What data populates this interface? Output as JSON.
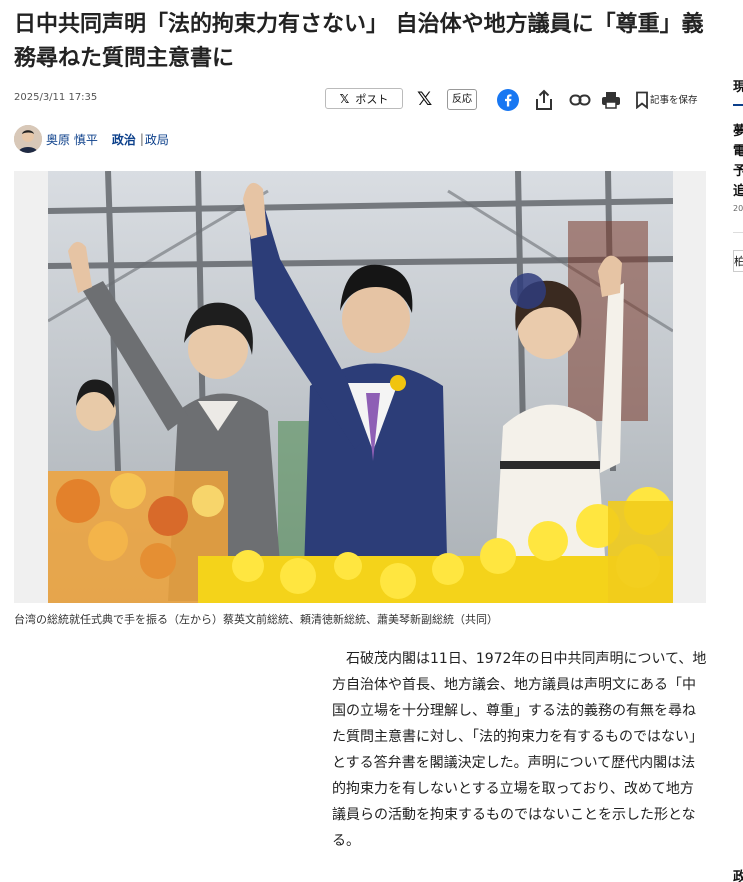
{
  "article": {
    "title": "日中共同声明「法的拘束力有さない」 自治体や地方議員に「尊重」義務尋ねた質問主意書に",
    "date": "2025/3/11 17:35",
    "author": "奥原 慎平",
    "category": "政治",
    "subcategory": "政局",
    "caption": "台湾の総統就任式典で手を振る（左から）蔡英文前総統、頼清徳新総統、蕭美琴新副総統（共同）",
    "body": "石破茂内閣は11日、1972年の日中共同声明について、地方自治体や首長、地方議会、地方議員は声明文にある「中国の立場を十分理解し、尊重」する法的義務の有無を尋ねた質問主意書に対し、「法的拘束力を有するものではない」とする答弁書を閣議決定した。声明について歴代内閣は法的拘束力を有しないとする立場を取っており、改めて地方議員らの活動を拘束するものではないことを示した形となる。"
  },
  "share": {
    "x_post_label": "ポスト",
    "x_glyph": "𝕏",
    "reaction_label": "反応",
    "save_label": "記事を保存",
    "icons": [
      "x-icon",
      "facebook-icon",
      "share-icon",
      "link-icon",
      "print-icon",
      "bookmark-icon"
    ]
  },
  "sidebar": {
    "fragments": [
      "現",
      "夢",
      "電",
      "予",
      "追",
      "20",
      "柏",
      "政"
    ]
  },
  "colors": {
    "link": "#0b3f8a",
    "facebook": "#1877f2",
    "text": "#222222",
    "photo_bg": "#f0f0f0"
  }
}
